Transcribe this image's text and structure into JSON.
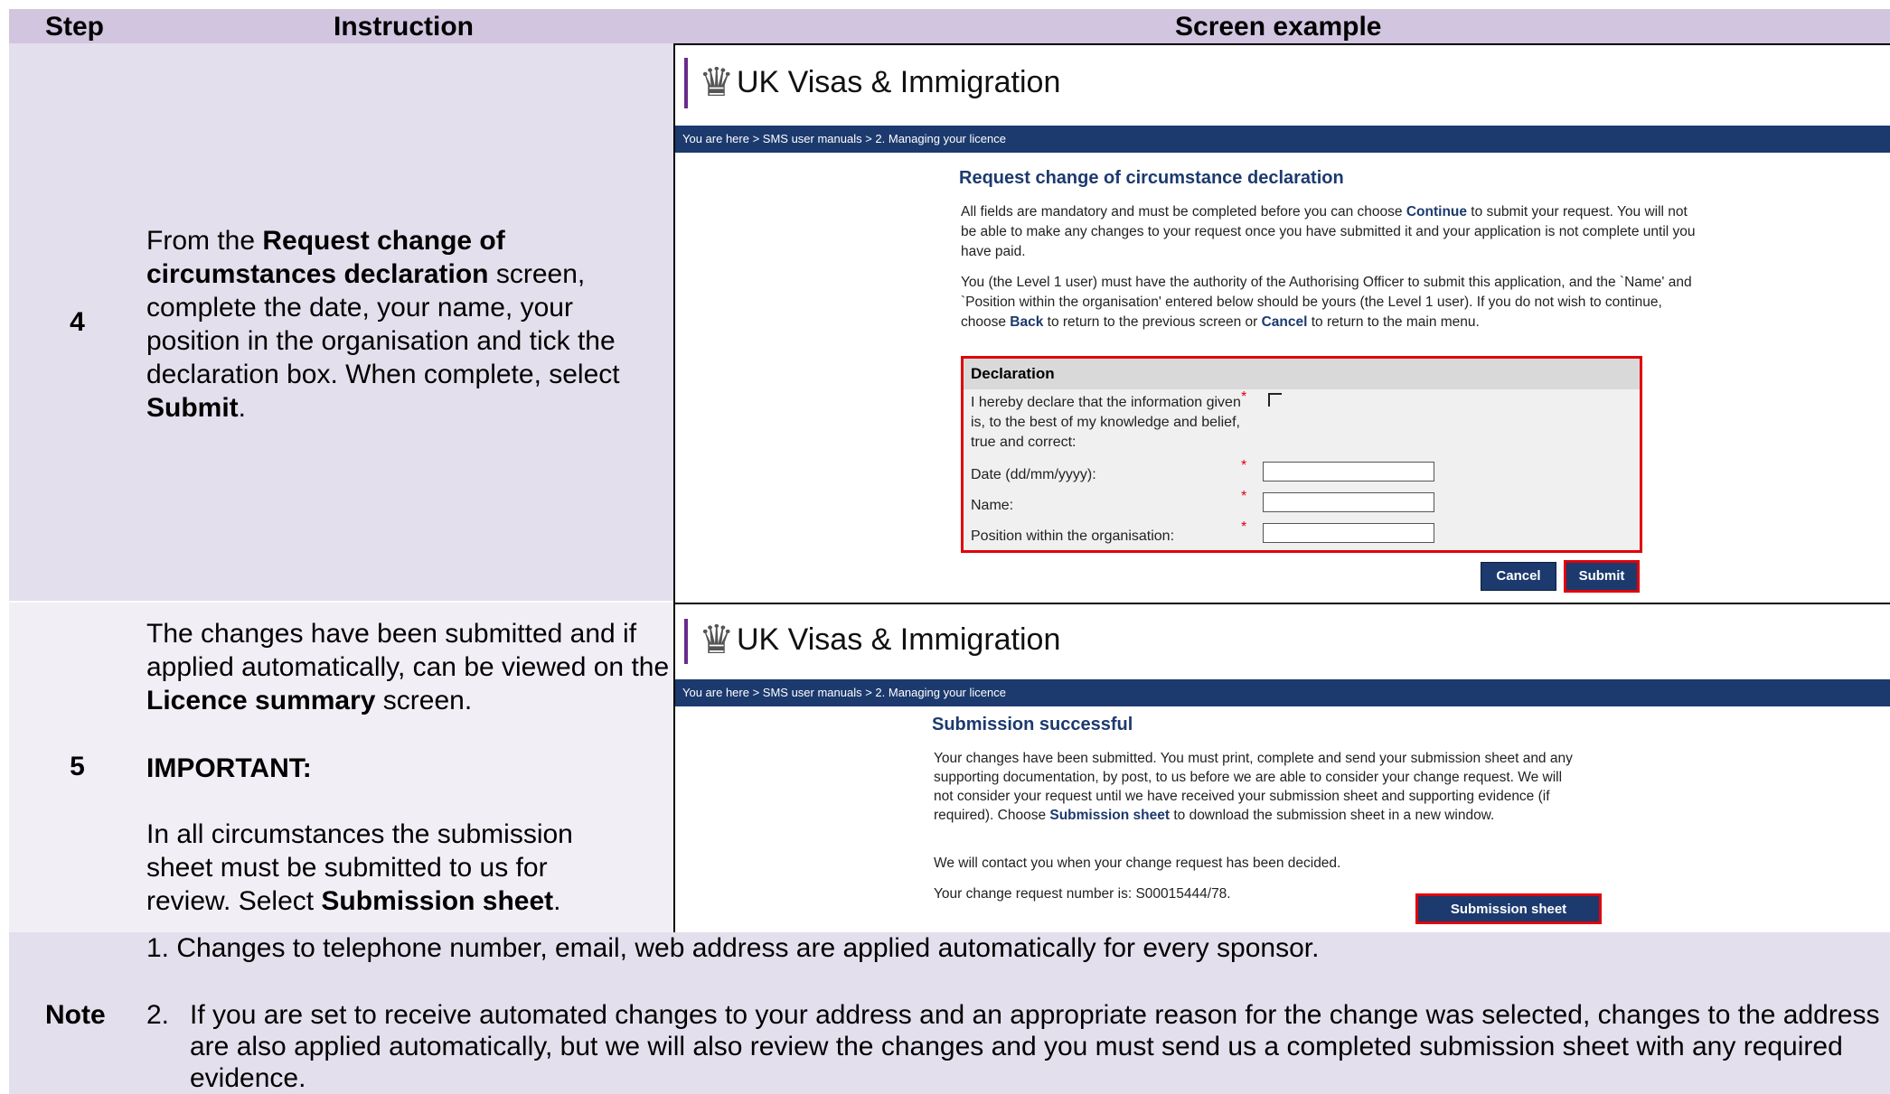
{
  "table_header": {
    "step": "Step",
    "instruction": "Instruction",
    "screen": "Screen example"
  },
  "step4": {
    "number": "4",
    "pre": "From the ",
    "bold1": "Request change of circumstances declaration",
    "mid": " screen, complete the date, your name, your position in the organisation and tick the declaration box. When complete, select ",
    "bold2": "Submit",
    "post": "."
  },
  "step5": {
    "number": "5",
    "line1_pre": "The changes have been submitted and if applied automatically, can be viewed on the ",
    "line1_bold": "Licence summary",
    "line1_post": " screen.",
    "important": "IMPORTANT:",
    "line2_pre": "In all circumstances the submission sheet must be submitted to us for review. Select ",
    "line2_bold": "Submission sheet",
    "line2_post": "."
  },
  "screen_common": {
    "brand": "UK Visas & Immigration",
    "crest": "♛",
    "breadcrumb": "You are here > SMS user manuals > 2. Managing your licence"
  },
  "screen4": {
    "title": "Request change of circumstance declaration",
    "p1_pre": "All fields are mandatory and must be completed before you can choose ",
    "p1_b": "Continue",
    "p1_post": " to submit your request. You will not be able to make any changes to your request once you have submitted it and your application is not complete until you have paid.",
    "p2_pre": "You (the Level 1 user) must have the authority of the Authorising Officer to submit this application, and the `Name' and `Position within the organisation' entered below should be yours (the Level 1 user). If you do not wish to continue, choose ",
    "p2_b1": "Back",
    "p2_mid": " to return to the previous screen or ",
    "p2_b2": "Cancel",
    "p2_post": " to return to the main menu.",
    "declaration_heading": "Declaration",
    "declare_label": "I hereby declare that the information given is, to the best of my knowledge and belief, true and correct:",
    "date_label": "Date (dd/mm/yyyy):",
    "name_label": "Name:",
    "position_label": "Position within the organisation:",
    "required_mark": "*",
    "date_value": "",
    "name_value": "",
    "position_value": "",
    "cancel": "Cancel",
    "submit": "Submit"
  },
  "screen5": {
    "title": "Submission successful",
    "p1_pre": "Your changes have been submitted. You must print, complete and send your submission sheet and any supporting documentation, by post, to us before we are able to consider your change request. We will not consider your request until we have received your submission sheet and supporting evidence (if required). Choose ",
    "p1_b": "Submission sheet",
    "p1_post": " to download the submission sheet in a new window.",
    "p2": "We will contact you when your change request has been decided.",
    "p3": "Your change request number is: S00015444/78.",
    "button": "Submission sheet"
  },
  "note": {
    "label": "Note",
    "item1": "1.  Changes to telephone number, email, web address are applied automatically for every sponsor.",
    "item2_num": "2.",
    "item2": "If you are set to receive automated changes to your address and an appropriate reason for the change was selected, changes to the address are also applied automatically, but we will also review the changes and you must send us a completed submission sheet with any required evidence."
  },
  "colors": {
    "header": "#d2c5df",
    "row_dark": "#e4dfec",
    "row_light": "#f1eef5",
    "navy": "#1c3a6e",
    "highlight": "#e0000b"
  }
}
